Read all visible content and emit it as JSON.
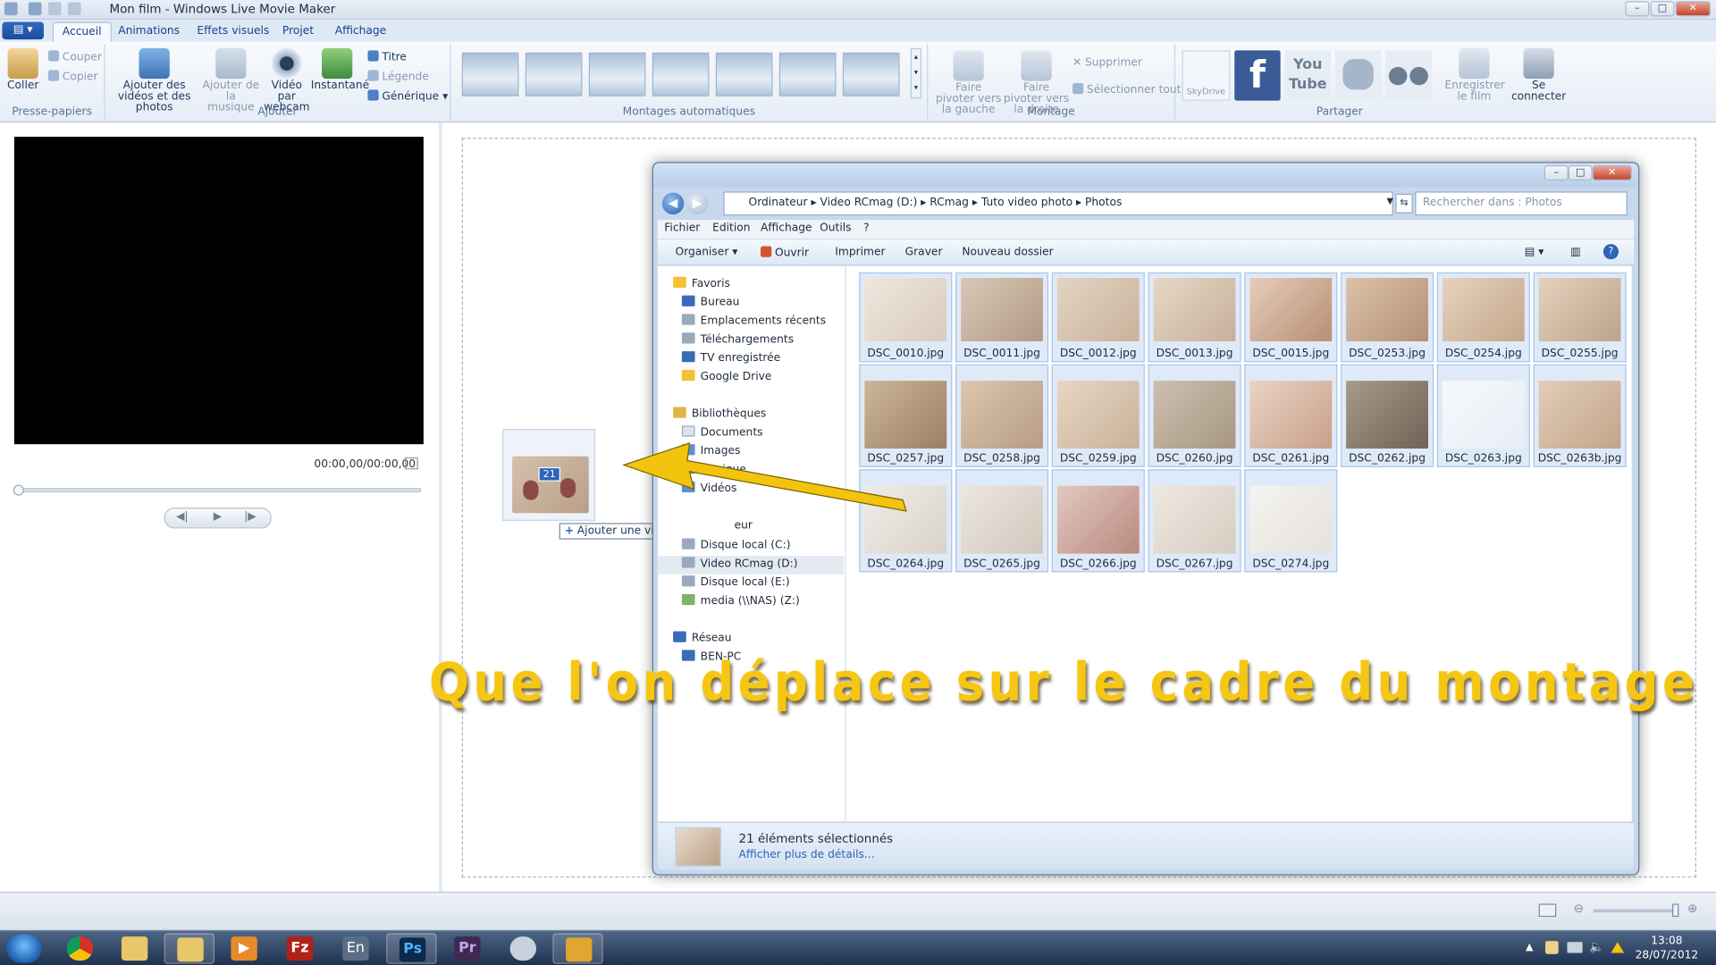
{
  "app": {
    "title": "Mon film - Windows Live Movie Maker",
    "menu_button": "▤ ▾"
  },
  "tabs": [
    {
      "label": "Accueil",
      "active": true
    },
    {
      "label": "Animations"
    },
    {
      "label": "Effets visuels"
    },
    {
      "label": "Projet"
    },
    {
      "label": "Affichage"
    }
  ],
  "ribbon": {
    "clipboard": {
      "paste": "Coller",
      "cut": "Couper",
      "copy": "Copier",
      "group": "Presse-papiers"
    },
    "add": {
      "add_media": "Ajouter des vidéos et des photos",
      "add_music": "Ajouter de la musique",
      "webcam": "Vidéo par webcam",
      "snapshot": "Instantané",
      "title": "Titre",
      "caption": "Légende",
      "credits": "Générique",
      "group": "Ajouter"
    },
    "automovie": {
      "group": "Montages automatiques",
      "theme_count": 7
    },
    "editing": {
      "rotate_left": "Faire pivoter vers la gauche",
      "rotate_right": "Faire pivoter vers la droite",
      "delete": "Supprimer",
      "select_all": "Sélectionner tout",
      "group": "Montage"
    },
    "share": {
      "skydrive": "SkyDrive",
      "facebook": "f",
      "youtube": "You Tube",
      "save_movie": "Enregistrer le film",
      "sign_in": "Se connecter",
      "group": "Partager"
    }
  },
  "preview": {
    "timecode": "00:00,00/00:00,00",
    "prev_icon": "◀|",
    "play_icon": "▶",
    "next_icon": "|▶"
  },
  "drag": {
    "count": "21",
    "tooltip": "Ajouter une vidéo ou une photo",
    "plus": "+"
  },
  "explorer": {
    "breadcrumb": "Ordinateur  ▸  Video RCmag (D:)  ▸  RCmag  ▸  Tuto video photo  ▸  Photos",
    "search_placeholder": "Rechercher dans : Photos",
    "menus": [
      "Fichier",
      "Edition",
      "Affichage",
      "Outils",
      "?"
    ],
    "commands": {
      "organize": "Organiser ▾",
      "open": "Ouvrir",
      "print": "Imprimer",
      "burn": "Graver",
      "new_folder": "Nouveau dossier"
    },
    "nav": {
      "favorites": "Favoris",
      "fav_items": [
        "Bureau",
        "Emplacements récents",
        "Téléchargements",
        "TV enregistrée",
        "Google Drive"
      ],
      "libraries": "Bibliothèques",
      "lib_items": [
        "Documents",
        "Images",
        "Musique",
        "Vidéos"
      ],
      "computer": "Ordinateur",
      "computer_partial": "eur",
      "drives": [
        "Disque local (C:)",
        "Video RCmag (D:)",
        "Disque local (E:)",
        "media (\\\\NAS) (Z:)"
      ],
      "network": "Réseau",
      "net_items": [
        "BEN-PC"
      ]
    },
    "files": [
      "DSC_0010.jpg",
      "DSC_0011.jpg",
      "DSC_0012.jpg",
      "DSC_0013.jpg",
      "DSC_0015.jpg",
      "DSC_0253.jpg",
      "DSC_0254.jpg",
      "DSC_0255.jpg",
      "DSC_0257.jpg",
      "DSC_0258.jpg",
      "DSC_0259.jpg",
      "DSC_0260.jpg",
      "DSC_0261.jpg",
      "DSC_0262.jpg",
      "DSC_0263.jpg",
      "DSC_0263b.jpg",
      "DSC_0264.jpg",
      "DSC_0265.jpg",
      "DSC_0266.jpg",
      "DSC_0267.jpg",
      "DSC_0274.jpg"
    ],
    "status": {
      "selected": "21 éléments sélectionnés",
      "more": "Afficher plus de détails..."
    }
  },
  "overlay_text": "Que l'on déplace sur le cadre du montage",
  "taskbar": {
    "apps": [
      "start",
      "chrome",
      "explorer",
      "explorer-active",
      "movie-maker",
      "filezilla",
      "En",
      "Ps",
      "Pr",
      "misc",
      "movie-maker-active"
    ],
    "labels": {
      "filezilla": "Fz",
      "en": "En",
      "ps": "Ps",
      "pr": "Pr"
    },
    "time": "13:08",
    "date": "28/07/2012"
  },
  "colors": {
    "accent": "#1e5fb0",
    "overlay_yellow": "#f6c712",
    "arrow": "#f2c40e"
  }
}
